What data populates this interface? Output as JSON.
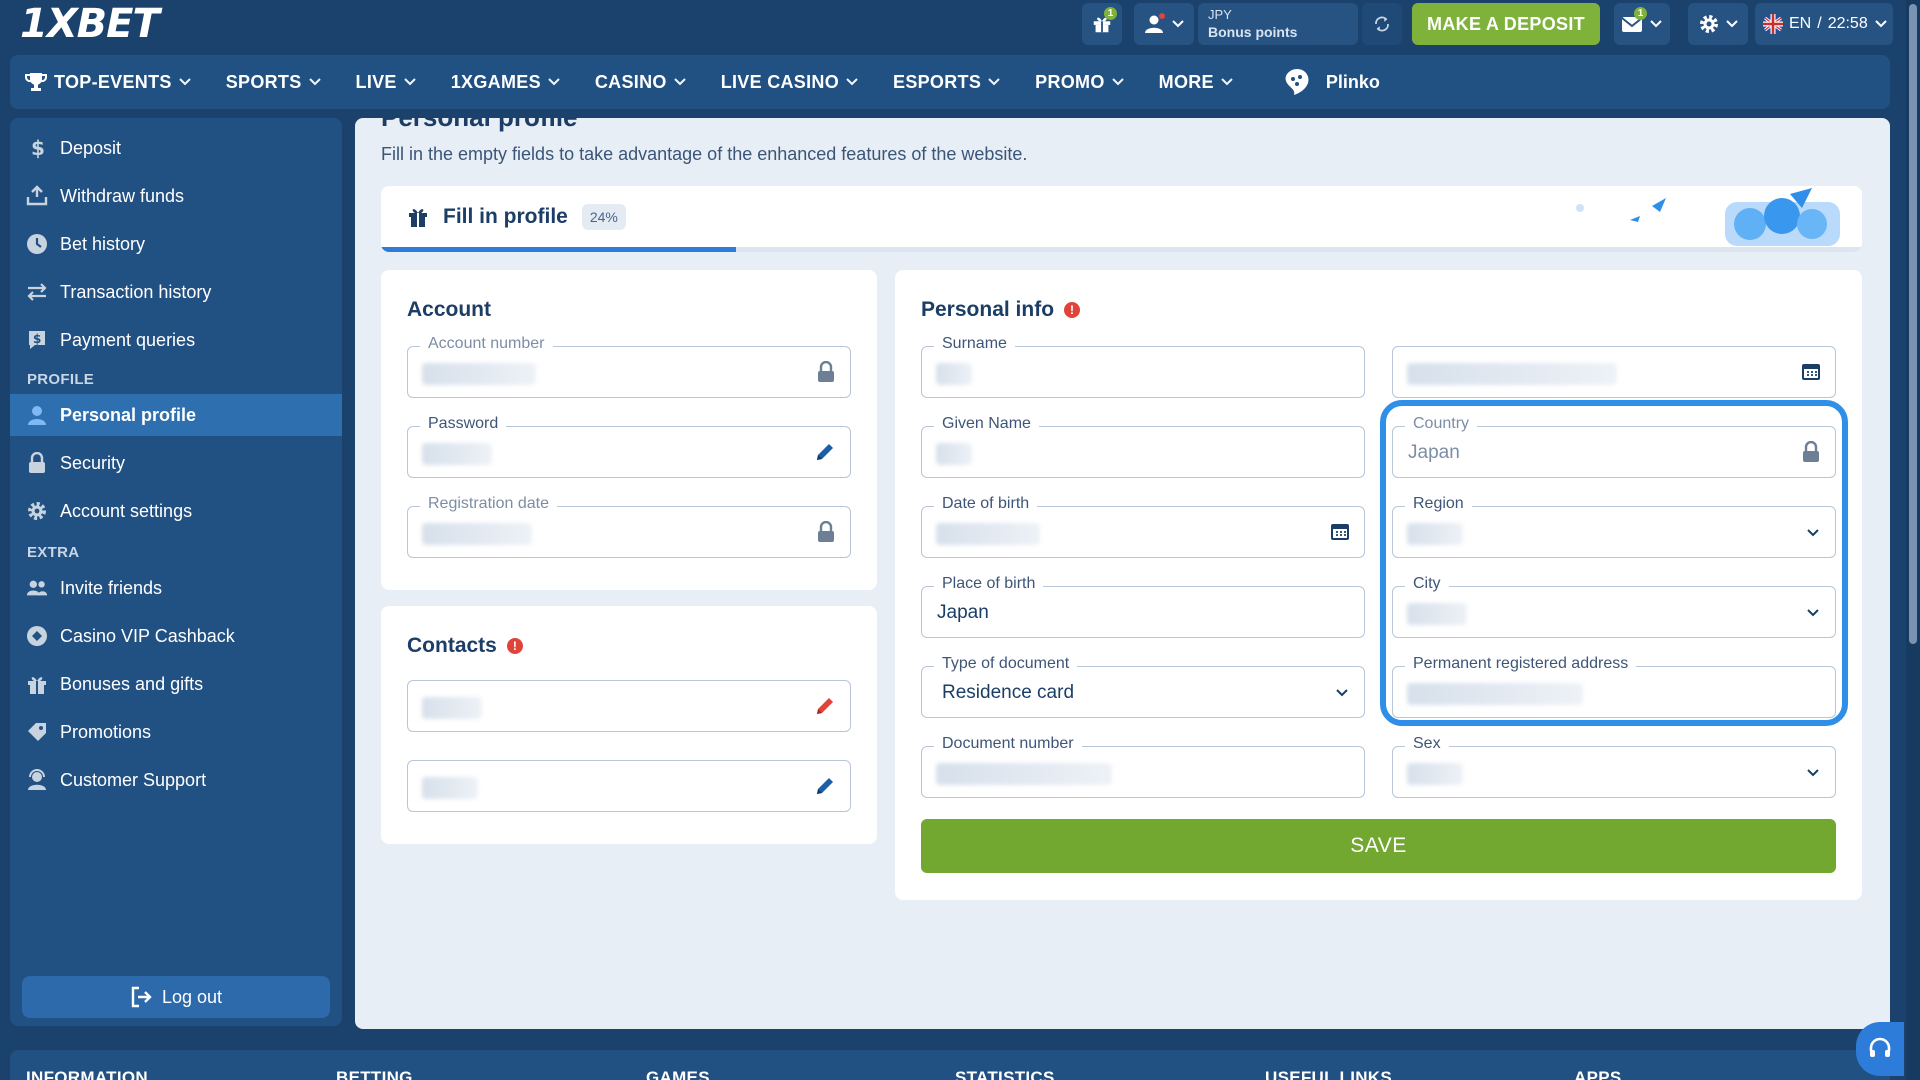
{
  "brand": {
    "logo_text": "1XBET"
  },
  "topbar": {
    "gift_count": "1",
    "messages_count": "1",
    "currency": "JPY",
    "bonus_points_label": "Bonus points",
    "deposit_label": "MAKE A DEPOSIT",
    "language": "EN",
    "separator": "/",
    "time": "22:58"
  },
  "nav": {
    "items": [
      {
        "label": "TOP-EVENTS"
      },
      {
        "label": "SPORTS"
      },
      {
        "label": "LIVE"
      },
      {
        "label": "1XGAMES"
      },
      {
        "label": "CASINO"
      },
      {
        "label": "LIVE CASINO"
      },
      {
        "label": "ESPORTS"
      },
      {
        "label": "PROMO"
      },
      {
        "label": "MORE"
      }
    ],
    "plinko_label": "Plinko"
  },
  "sidebar": {
    "items": [
      {
        "label": "Deposit",
        "icon": "dollar-icon"
      },
      {
        "label": "Withdraw funds",
        "icon": "withdraw-icon"
      },
      {
        "label": "Bet history",
        "icon": "clock-icon"
      },
      {
        "label": "Transaction history",
        "icon": "transfer-icon"
      },
      {
        "label": "Payment queries",
        "icon": "payment-query-icon"
      }
    ],
    "profile_section": "PROFILE",
    "profile_items": [
      {
        "label": "Personal profile",
        "icon": "user-icon",
        "active": true
      },
      {
        "label": "Security",
        "icon": "lock-icon"
      },
      {
        "label": "Account settings",
        "icon": "gear-icon"
      }
    ],
    "extra_section": "EXTRA",
    "extra_items": [
      {
        "label": "Invite friends",
        "icon": "users-icon"
      },
      {
        "label": "Casino VIP Cashback",
        "icon": "cashback-icon"
      },
      {
        "label": "Bonuses and gifts",
        "icon": "gift-icon"
      },
      {
        "label": "Promotions",
        "icon": "tag-icon"
      },
      {
        "label": "Customer Support",
        "icon": "support-icon"
      }
    ],
    "logout_label": "Log out"
  },
  "page": {
    "title": "Personal profile",
    "subtitle": "Fill in the empty fields to take advantage of the enhanced features of the website."
  },
  "fill_profile": {
    "label": "Fill in profile",
    "percent_label": "24%",
    "progress": 0.24
  },
  "account": {
    "title": "Account",
    "fields": {
      "account_number": "Account number",
      "password": "Password",
      "registration_date": "Registration date"
    }
  },
  "contacts": {
    "title": "Contacts"
  },
  "personal_info": {
    "title": "Personal info",
    "fields": {
      "surname": "Surname",
      "given_name": "Given Name",
      "date_of_birth": "Date of birth",
      "place_of_birth": "Place of birth",
      "place_of_birth_value": "Japan",
      "type_of_document": "Type of document",
      "type_of_document_value": "Residence card",
      "document_number": "Document number",
      "country": "Country",
      "country_value": "Japan",
      "region": "Region",
      "city": "City",
      "permanent_address": "Permanent registered address",
      "sex": "Sex"
    },
    "save_label": "SAVE"
  },
  "footer": {
    "columns": [
      "INFORMATION",
      "BETTING",
      "GAMES",
      "STATISTICS",
      "USEFUL LINKS",
      "APPS"
    ]
  },
  "colors": {
    "background": "#1a426c",
    "panel": "#215082",
    "active": "#2e6fb0",
    "green": "#7fb23a",
    "accent_blue": "#2f8ee8"
  }
}
